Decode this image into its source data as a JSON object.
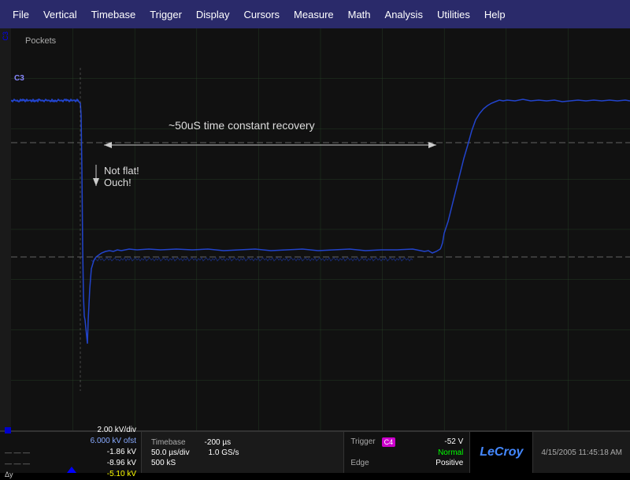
{
  "menubar": {
    "items": [
      "File",
      "Vertical",
      "Timebase",
      "Trigger",
      "Display",
      "Cursors",
      "Measure",
      "Math",
      "Analysis",
      "Utilities",
      "Help"
    ]
  },
  "display": {
    "channel_label": "C3",
    "pockets_label": "Pockets",
    "annotation1_text": "~50uS time constant recovery",
    "annotation2_text": "Not flat!",
    "annotation3_text": "Ouch!"
  },
  "status": {
    "channel": {
      "volts_div": "2.00 kV/div",
      "offset": "6.000 kV ofst",
      "cursor1": "-1.86 kV",
      "cursor2": "-8.96 kV",
      "delta_y": "-5.10 kV"
    },
    "timebase": {
      "label": "Timebase",
      "value": "-200 µs",
      "div_label": "50.0 µs/div",
      "samples_label": "500 kS",
      "sample_rate": "1.0 GS/s"
    },
    "trigger": {
      "label": "Trigger",
      "mode": "Normal",
      "level": "-52 V",
      "type": "Edge",
      "slope": "Positive",
      "badge": "C4"
    },
    "datetime": "4/15/2005  11:45:18 AM",
    "logo": "LeCroy"
  },
  "colors": {
    "background": "#1a1a1a",
    "grid": "#2a3a2a",
    "trace": "#0000dd",
    "menu_bg": "#2a2a6a",
    "text_white": "#ffffff",
    "text_gray": "#aaaaaa",
    "logo_blue": "#4488ff"
  }
}
